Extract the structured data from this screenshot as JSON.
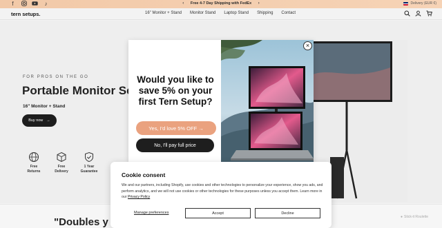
{
  "topbar": {
    "promo": "Free 4-7 Day Shipping with FedEx",
    "prev_arrow": "‹",
    "next_arrow": "›",
    "delivery": "Delivery (EUR €)",
    "socials": [
      "facebook-icon",
      "instagram-icon",
      "youtube-icon",
      "tiktok-icon"
    ]
  },
  "header": {
    "logo": "tern setups.",
    "nav": [
      "16\" Monitor + Stand",
      "Monitor Stand",
      "Laptop Stand",
      "Shipping",
      "Contact"
    ],
    "icons": [
      "search-icon",
      "account-icon",
      "cart-icon"
    ]
  },
  "hero": {
    "eyebrow": "FOR PROS ON THE GO",
    "title": "Portable Monitor Se",
    "subtitle": "16\" Monitor + Stand",
    "buy_label": "Buy now",
    "perks": [
      {
        "line1": "Free",
        "line2": "Returns"
      },
      {
        "line1": "Free",
        "line2": "Delivery"
      },
      {
        "line1": "1 Year",
        "line2": "Guarantee"
      }
    ]
  },
  "section": {
    "heading": "\"Doubles y",
    "sticker": "Stick-it Roulette"
  },
  "popup": {
    "title": "Would you like to save 5% on your first Tern Setup?",
    "yes_label": "Yes, I'd love 5% OFF →",
    "no_label": "No, I'll pay full price",
    "close": "×"
  },
  "cookie": {
    "title": "Cookie consent",
    "text": "We and our partners, including Shopify, use cookies and other technologies to personalize your experience, show you ads, and perform analytics, and we will not use cookies or other technologies for these purposes unless you accept them. Learn more in our ",
    "policy_link": "Privacy Policy",
    "manage": "Manage preferences",
    "accept": "Accept",
    "decline": "Decline"
  },
  "colors": {
    "accent_peach": "#eaa27f",
    "dark": "#1e1e1e",
    "topbar": "#f4cfb1"
  }
}
